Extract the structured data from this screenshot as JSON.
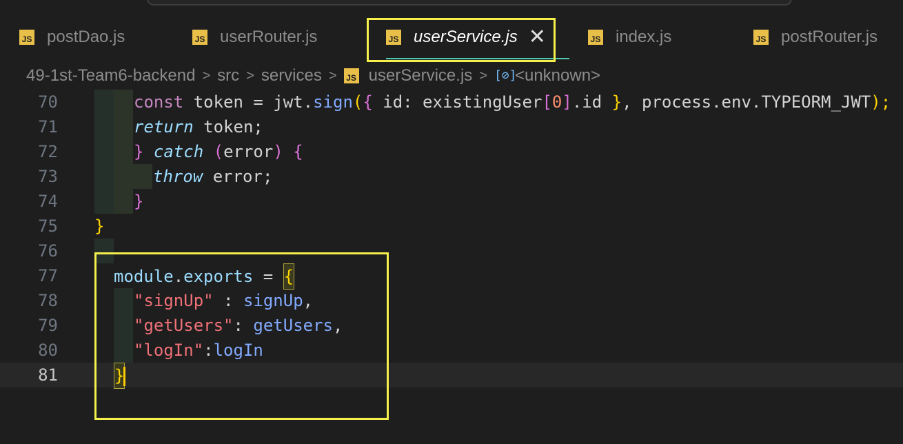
{
  "tabs": [
    {
      "label": "postDao.js",
      "icon": "js-file-icon"
    },
    {
      "label": "userRouter.js",
      "icon": "js-file-icon"
    },
    {
      "label": "userService.js",
      "icon": "js-file-icon",
      "active": true
    },
    {
      "label": "index.js",
      "icon": "js-file-icon"
    },
    {
      "label": "postRouter.js",
      "icon": "js-file-icon"
    }
  ],
  "js_icon_text": "JS",
  "close_glyph": "✕",
  "breadcrumb": {
    "project": "49-1st-Team6-backend",
    "folder1": "src",
    "folder2": "services",
    "file": "userService.js",
    "symbol": "<unknown>",
    "separator": ">",
    "symbol_icon": "[⊘]"
  },
  "lines": [
    {
      "n": "70"
    },
    {
      "n": "71"
    },
    {
      "n": "72"
    },
    {
      "n": "73"
    },
    {
      "n": "74"
    },
    {
      "n": "75"
    },
    {
      "n": "76"
    },
    {
      "n": "77"
    },
    {
      "n": "78"
    },
    {
      "n": "79"
    },
    {
      "n": "80"
    },
    {
      "n": "81"
    }
  ],
  "code": {
    "l70": {
      "kw": "const",
      "a": " token = ",
      "fn1": "jwt",
      "b": ".",
      "fn2": "sign",
      "p1": "(",
      "c1": "{",
      "d": " id: existingUser",
      "c2": "[",
      "num": "0",
      "c3": "]",
      "e": ".id ",
      "c4": "}",
      "f": ", process.env.TYPEORM_JWT",
      "p2": ");"
    },
    "l71": {
      "kw": "return",
      "a": " token;"
    },
    "l72": {
      "br": "}",
      "kw": " catch",
      "a": " ",
      "p1": "(",
      "b": "error",
      "p2": ")",
      "c": " ",
      "br2": "{"
    },
    "l73": {
      "kw": "throw",
      "a": " error;"
    },
    "l74": {
      "br": "}"
    },
    "l75": {
      "br": "}"
    },
    "l77": {
      "a": "module",
      "b": ".",
      "c": "exports",
      "d": " = ",
      "br": "{"
    },
    "l78": {
      "s": "\"signUp\"",
      "a": " : ",
      "v": "signUp",
      "b": ","
    },
    "l79": {
      "s": "\"getUsers\"",
      "a": ": ",
      "v": "getUsers",
      "b": ","
    },
    "l80": {
      "s": "\"logIn\"",
      "a": ":",
      "v": "logIn"
    },
    "l81": {
      "br": "}"
    }
  },
  "colors": {
    "highlight": "#f5f04b",
    "js_icon": "#e8bf49",
    "background": "#1e1e1e"
  }
}
